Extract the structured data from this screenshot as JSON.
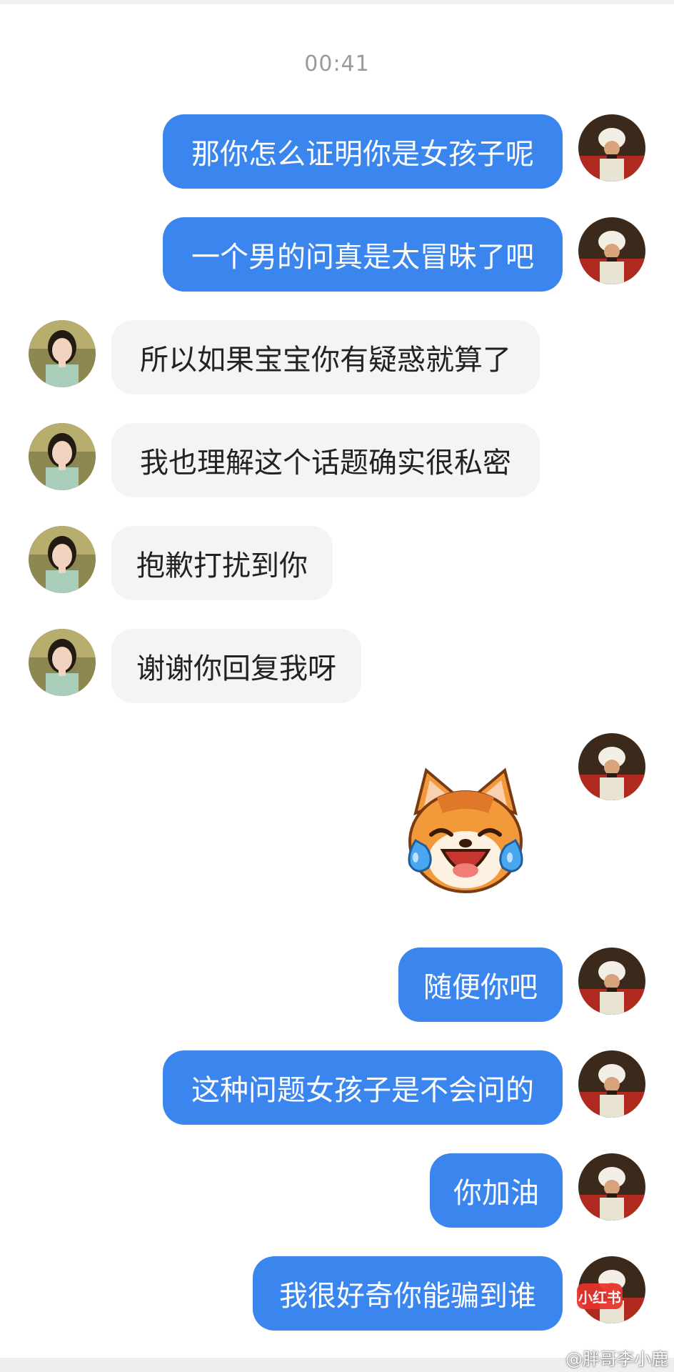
{
  "chat": {
    "timestamp": "00:41",
    "messages": [
      {
        "text": "那你怎么证明你是女孩子呢"
      },
      {
        "text": "一个男的问真是太冒昧了吧"
      },
      {
        "text": "所以如果宝宝你有疑惑就算了"
      },
      {
        "text": "我也理解这个话题确实很私密"
      },
      {
        "text": "抱歉打扰到你"
      },
      {
        "text": "谢谢你回复我呀"
      },
      {
        "text": "随便你吧"
      },
      {
        "text": "这种问题女孩子是不会问的"
      },
      {
        "text": "你加油"
      },
      {
        "text": "我很好奇你能骗到谁"
      }
    ],
    "sticker": {
      "icon": "laughing-crying-cat-sticker"
    }
  },
  "watermark": {
    "logo_text": "小红书",
    "text": "@胖哥李小鹿"
  },
  "colors": {
    "sent_bubble": "#3a86ee",
    "received_bubble": "#f4f4f5",
    "timestamp": "#9a9a9a"
  }
}
